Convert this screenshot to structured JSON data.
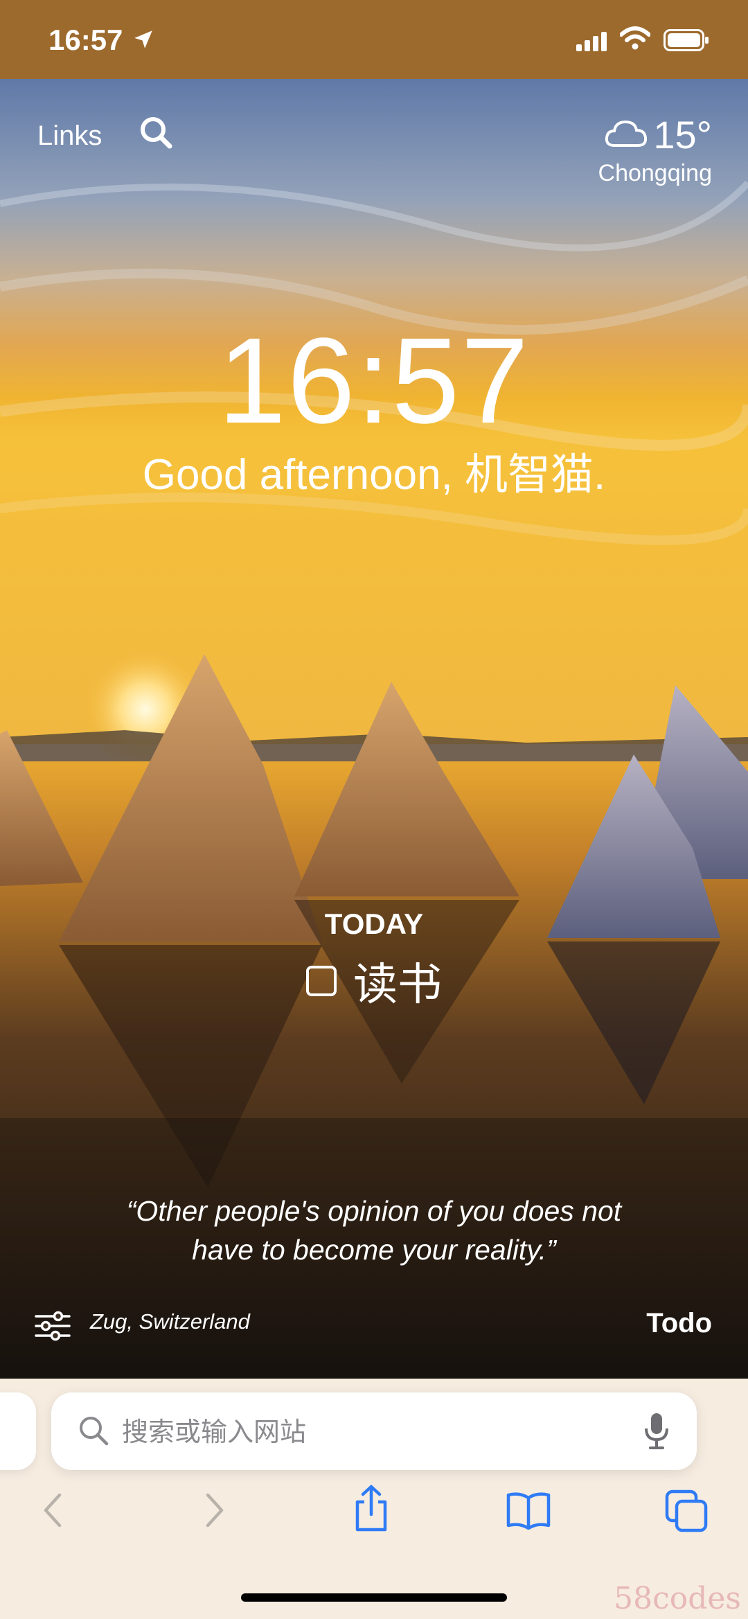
{
  "status_bar": {
    "time": "16:57",
    "icons": [
      "location-arrow-icon",
      "cellular-signal-icon",
      "wifi-icon",
      "battery-icon"
    ]
  },
  "top_bar": {
    "links_label": "Links",
    "search_icon": "search-icon",
    "weather": {
      "icon": "cloud-icon",
      "temperature": "15°",
      "city": "Chongqing"
    }
  },
  "center": {
    "clock": "16:57",
    "greeting": "Good afternoon, 机智猫."
  },
  "todo": {
    "heading": "TODAY",
    "items": [
      {
        "text": "读书",
        "checked": false
      }
    ]
  },
  "quote": {
    "text": "“Other people's opinion of you does not have to become your reality.”"
  },
  "footer": {
    "settings_icon": "sliders-icon",
    "photo_location": "Zug, Switzerland",
    "todo_label": "Todo"
  },
  "browser": {
    "search_placeholder": "搜索或输入网站",
    "toolbar_icons": [
      "back-icon",
      "forward-icon",
      "share-icon",
      "bookmarks-icon",
      "tabs-icon"
    ]
  },
  "watermark": "58codes",
  "colors": {
    "status_bar_bg": "#9d6a2d",
    "browser_bg": "#f6ece0",
    "toolbar_active": "#2f7bf5",
    "toolbar_disabled": "#b9b2ab"
  }
}
